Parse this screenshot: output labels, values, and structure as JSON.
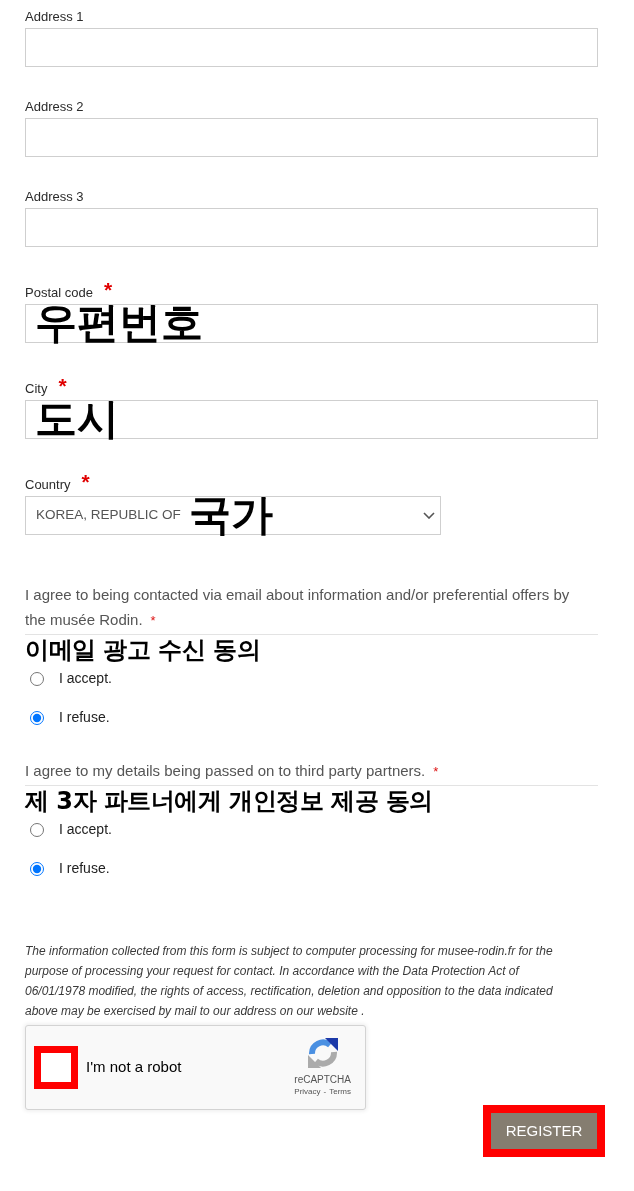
{
  "fields": [
    {
      "label": "Address 1",
      "required": false,
      "kind": "text"
    },
    {
      "label": "Address 2",
      "required": false,
      "kind": "text"
    },
    {
      "label": "Address 3",
      "required": false,
      "kind": "text"
    },
    {
      "label": "Postal code",
      "required": true,
      "kind": "text",
      "annotation": "우편번호"
    },
    {
      "label": "City",
      "required": true,
      "kind": "text",
      "annotation": "도시"
    },
    {
      "label": "Country",
      "required": true,
      "kind": "select",
      "value": "KOREA, REPUBLIC OF",
      "annotation": "국가"
    }
  ],
  "required_marker": "*",
  "consents": [
    {
      "text": "I agree to being contacted via email about information and/or preferential offers by the musée Rodin.",
      "required": true,
      "annotation": "이메일 광고 수신 동의",
      "options": [
        {
          "label": "I accept.",
          "selected": false
        },
        {
          "label": "I refuse.",
          "selected": true
        }
      ]
    },
    {
      "text": "I agree to my details being passed on to third party partners.",
      "required": true,
      "annotation": "제 3자 파트너에게 개인정보 제공 동의",
      "options": [
        {
          "label": "I accept.",
          "selected": false
        },
        {
          "label": "I refuse.",
          "selected": true
        }
      ]
    }
  ],
  "notice": "The information collected from this form is subject to computer processing for musee-rodin.fr for the purpose of processing your request for contact. In accordance with the Data Protection Act of 06/01/1978 modified, the rights of access, rectification, deletion and opposition to the data indicated above may be exercised by mail to our address on our website .",
  "captcha": {
    "label": "I'm not a robot",
    "checked": false,
    "highlighted": true,
    "brand": "reCAPTCHA",
    "privacy_link": "Privacy",
    "separator": "-",
    "terms_link": "Terms"
  },
  "submit": {
    "label": "REGISTER",
    "highlighted": true
  }
}
